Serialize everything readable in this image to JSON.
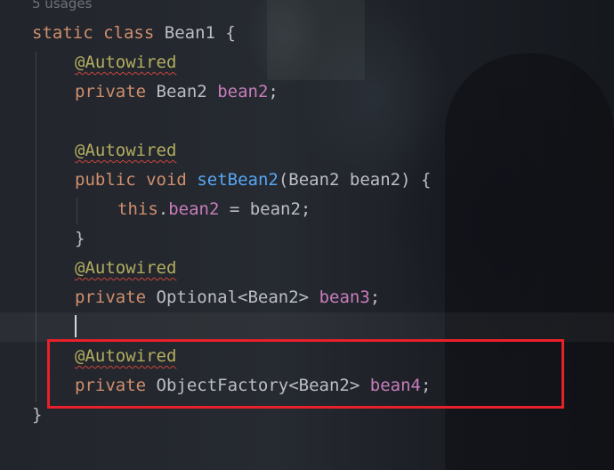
{
  "editor": {
    "usages_hint": "5 usages",
    "class_decl": {
      "static": "static",
      "class": "class",
      "name": "Bean1",
      "brace": " {"
    },
    "field1": {
      "annotation": "@Autowired",
      "modifier": "private",
      "type": "Bean2",
      "name": "bean2",
      "semicolon": ";"
    },
    "method": {
      "annotation": "@Autowired",
      "modifier": "public",
      "return_type": "void",
      "name": "setBean2",
      "params": "(Bean2 bean2) {",
      "body_this": "this",
      "body_dot": ".",
      "body_field": "bean2",
      "body_rest": " = bean2;",
      "close": "}"
    },
    "field2": {
      "annotation": "@Autowired",
      "modifier": "private",
      "type": "Optional<Bean2>",
      "name": "bean3",
      "semicolon": ";"
    },
    "field3": {
      "annotation": "@Autowired",
      "modifier": "private",
      "type": "ObjectFactory<Bean2>",
      "name": "bean4",
      "semicolon": ";"
    },
    "class_close": "}"
  },
  "colors": {
    "keyword": "#cf8e6d",
    "annotation": "#b3ae60",
    "field": "#c77dbb",
    "method": "#56a8f5",
    "text": "#bcbec4",
    "highlight_box": "#e8202a"
  }
}
